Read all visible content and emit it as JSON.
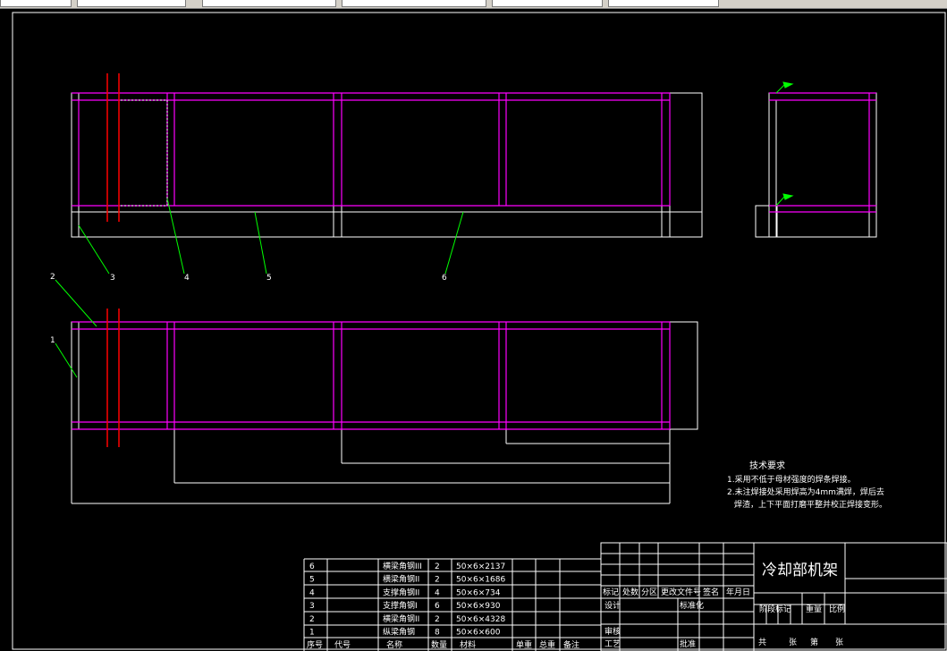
{
  "title_block": {
    "drawing_title": "冷却部机架",
    "rev_headers": [
      "标记",
      "处数",
      "分区",
      "更改文件号",
      "签名",
      "年月日"
    ],
    "row_design": "设计",
    "row_standard": "标准化",
    "stage_mark": "阶段标记",
    "weight": "重量",
    "scale": "比例",
    "row_review": "审核",
    "row_process": "工艺",
    "row_approve": "批准",
    "sheets_total": "共",
    "sheets_unit": "张",
    "sheet_no": "第",
    "sheet_unit": "张"
  },
  "bom": {
    "headers": [
      "序号",
      "代号",
      "名称",
      "数量",
      "材料",
      "单重",
      "总重",
      "备注"
    ],
    "rows": [
      {
        "no": "6",
        "name": "横梁角钢III",
        "qty": "2",
        "material": "50×6×2137"
      },
      {
        "no": "5",
        "name": "横梁角钢II",
        "qty": "2",
        "material": "50×6×1686"
      },
      {
        "no": "4",
        "name": "支撑角钢II",
        "qty": "4",
        "material": "50×6×734"
      },
      {
        "no": "3",
        "name": "支撑角钢I",
        "qty": "6",
        "material": "50×6×930"
      },
      {
        "no": "2",
        "name": "横梁角钢II",
        "qty": "2",
        "material": "50×6×4328"
      },
      {
        "no": "1",
        "name": "纵梁角钢",
        "qty": "8",
        "material": "50×6×600"
      }
    ]
  },
  "tech_req": {
    "heading": "技术要求",
    "line1": "1.采用不低于母材强度的焊条焊接。",
    "line2": "2.未注焊接处采用焊高为4mm满焊，焊后去",
    "line3": "焊渣，上下平面打磨平整并校正焊接变形。"
  },
  "balloons": {
    "b1": "1",
    "b2": "2",
    "b3": "3",
    "b4": "4",
    "b5": "5",
    "b6": "6"
  },
  "colors": {
    "outline": "#ffffff",
    "beam": "#ff00ff",
    "section": "#ff0000",
    "leader": "#00ff00"
  }
}
